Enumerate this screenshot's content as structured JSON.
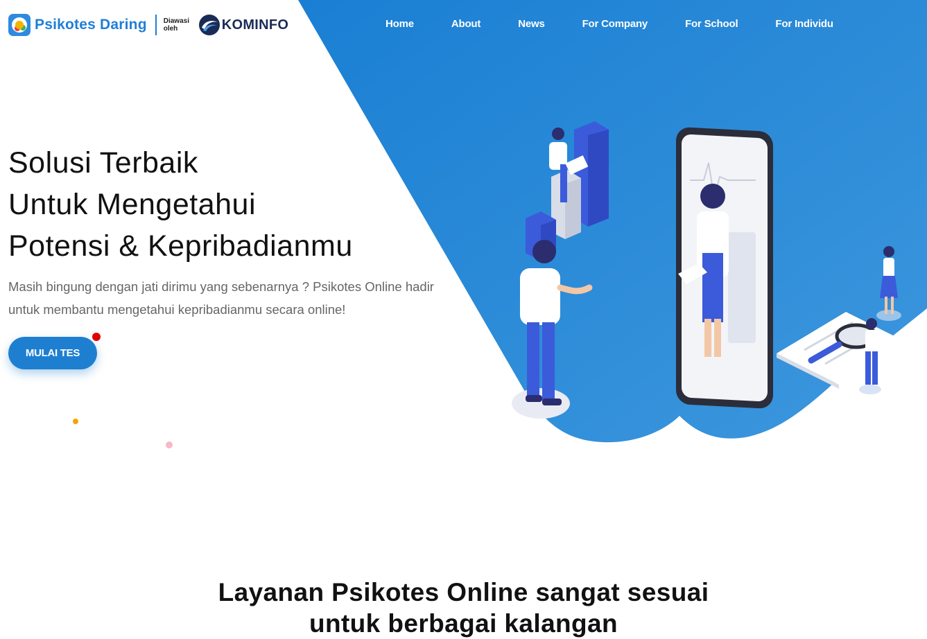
{
  "header": {
    "brand": "Psikotes Daring",
    "supervised_by": "Diawasi oleh",
    "partner": "KOMINFO",
    "nav": [
      "Home",
      "About",
      "News",
      "For Company",
      "For School",
      "For Individu"
    ]
  },
  "hero": {
    "title_lines": [
      "Solusi Terbaik",
      "Untuk Mengetahui",
      "Potensi & Kepribadianmu"
    ],
    "description": "Masih bingung dengan jati dirimu yang sebenarnya ? Psikotes Online hadir untuk membantu mengetahui kepribadianmu secara online!",
    "cta_label": "MULAI TES"
  },
  "section": {
    "title_lines": [
      "Layanan Psikotes Online sangat sesuai",
      "untuk berbagai kalangan"
    ]
  },
  "colors": {
    "primary": "#1e7fd1",
    "hero_blue_dark": "#1a7fd3",
    "hero_blue_light": "#3d97dd",
    "figure_blue": "#3b5bdb",
    "dot_red": "#e00000",
    "dot_orange": "#f6a300",
    "dot_pink": "#f7b8c8"
  },
  "icons": {
    "logo": "psikotes-logo-icon",
    "partner_logo": "kominfo-logo-icon"
  }
}
